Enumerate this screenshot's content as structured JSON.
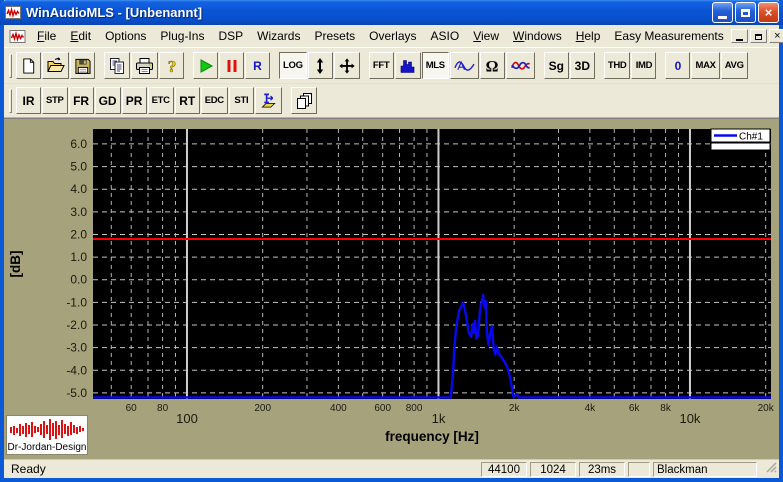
{
  "window": {
    "title": "WinAudioMLS - [Unbenannt]"
  },
  "menubar": {
    "items": [
      {
        "label": "File",
        "underline": 0
      },
      {
        "label": "Edit",
        "underline": 0
      },
      {
        "label": "Options"
      },
      {
        "label": "Plug-Ins"
      },
      {
        "label": "DSP"
      },
      {
        "label": "Wizards"
      },
      {
        "label": "Presets"
      },
      {
        "label": "Overlays"
      },
      {
        "label": "ASIO"
      },
      {
        "label": "View",
        "underline": 0
      },
      {
        "label": "Windows",
        "underline": 0
      },
      {
        "label": "Help",
        "underline": 0
      },
      {
        "label": "Easy Measurements"
      }
    ]
  },
  "toolbar_main": {
    "buttons": [
      {
        "name": "new-file-button",
        "icon": "new-doc"
      },
      {
        "name": "open-file-button",
        "icon": "open-folder"
      },
      {
        "name": "save-button",
        "icon": "save-floppy"
      },
      {
        "gap": true
      },
      {
        "name": "copy-button",
        "icon": "copy"
      },
      {
        "name": "print-button",
        "icon": "printer"
      },
      {
        "name": "help-button",
        "icon": "help"
      },
      {
        "gap": true
      },
      {
        "name": "play-button",
        "icon": "play"
      },
      {
        "name": "pause-button",
        "icon": "pause"
      },
      {
        "name": "record-button",
        "label": "R",
        "color": "#1414CC"
      },
      {
        "gap": true
      },
      {
        "name": "log-scale-button",
        "label": "LOG",
        "small": true,
        "active": true
      },
      {
        "name": "vertical-zoom-button",
        "icon": "v-arrows"
      },
      {
        "name": "pan-button",
        "icon": "move-arrows"
      },
      {
        "gap": true
      },
      {
        "name": "fft-button",
        "label": "FFT",
        "small": true
      },
      {
        "name": "spectrum-button",
        "icon": "spectrum-bars"
      },
      {
        "name": "mls-button",
        "label": "MLS",
        "small": true,
        "active": true
      },
      {
        "name": "scope-button",
        "icon": "scope-wave"
      },
      {
        "name": "impedance-button",
        "icon": "omega"
      },
      {
        "name": "wow-flutter-button",
        "icon": "dual-wave"
      },
      {
        "gap": true
      },
      {
        "name": "signal-generator-button",
        "label": "Sg"
      },
      {
        "name": "3d-view-button",
        "label": "3D"
      },
      {
        "gap": true
      },
      {
        "name": "thd-button",
        "label": "THD",
        "small": true
      },
      {
        "name": "imd-button",
        "label": "IMD",
        "small": true
      },
      {
        "gap": true
      },
      {
        "name": "zero-button",
        "label": "0",
        "color": "#1414CC"
      },
      {
        "name": "max-button",
        "label": "MAX",
        "small": true
      },
      {
        "name": "avg-button",
        "label": "AVG",
        "small": true
      }
    ]
  },
  "toolbar_measure": {
    "buttons": [
      {
        "name": "impulse-response-button",
        "label": "IR"
      },
      {
        "name": "step-response-button",
        "label": "STP",
        "small": true
      },
      {
        "name": "frequency-response-button",
        "label": "FR"
      },
      {
        "name": "group-delay-button",
        "label": "GD"
      },
      {
        "name": "phase-response-button",
        "label": "PR"
      },
      {
        "name": "energy-time-curve-button",
        "label": "ETC",
        "small": true
      },
      {
        "name": "reverberation-time-button",
        "label": "RT"
      },
      {
        "name": "energy-decay-curve-button",
        "label": "EDC",
        "small": true
      },
      {
        "name": "sti-button",
        "label": "STI",
        "small": true
      },
      {
        "name": "export-report-button",
        "icon": "export"
      },
      {
        "gap": true
      },
      {
        "name": "cascade-windows-button",
        "icon": "cascade"
      }
    ]
  },
  "chart_data": {
    "type": "line",
    "title": "",
    "xlabel": "frequency [Hz]",
    "ylabel": "[dB]",
    "x_scale": "log",
    "xlim": [
      42.3,
      21000
    ],
    "ylim": [
      -5.27,
      6.66
    ],
    "grid": true,
    "y_ticks": [
      {
        "v": 6,
        "label": "6.0"
      },
      {
        "v": 5,
        "label": "5.0"
      },
      {
        "v": 4,
        "label": "4.0"
      },
      {
        "v": 3,
        "label": "3.0"
      },
      {
        "v": 2,
        "label": "2.0"
      },
      {
        "v": 1,
        "label": "1.0"
      },
      {
        "v": 0,
        "label": "0.0"
      },
      {
        "v": -1,
        "label": "-1.0"
      },
      {
        "v": -2,
        "label": "-2.0"
      },
      {
        "v": -3,
        "label": "-3.0"
      },
      {
        "v": -4,
        "label": "-4.0"
      },
      {
        "v": -5,
        "label": "-5.0"
      }
    ],
    "x_major": [
      {
        "v": 100,
        "label": "100"
      },
      {
        "v": 1000,
        "label": "1k"
      },
      {
        "v": 10000,
        "label": "10k"
      }
    ],
    "x_minor": [
      {
        "v": 50
      },
      {
        "v": 60,
        "label": "60"
      },
      {
        "v": 70
      },
      {
        "v": 80,
        "label": "80"
      },
      {
        "v": 90
      },
      {
        "v": 200,
        "label": "200"
      },
      {
        "v": 300
      },
      {
        "v": 400,
        "label": "400"
      },
      {
        "v": 500
      },
      {
        "v": 600,
        "label": "600"
      },
      {
        "v": 700
      },
      {
        "v": 800,
        "label": "800"
      },
      {
        "v": 900
      },
      {
        "v": 2000,
        "label": "2k"
      },
      {
        "v": 3000
      },
      {
        "v": 4000,
        "label": "4k"
      },
      {
        "v": 5000
      },
      {
        "v": 6000,
        "label": "6k"
      },
      {
        "v": 7000
      },
      {
        "v": 8000,
        "label": "8k"
      },
      {
        "v": 9000
      },
      {
        "v": 20000,
        "label": "20k"
      }
    ],
    "overlay_line": {
      "db": 1.8,
      "color": "#FF0000"
    },
    "legend": {
      "position": "top-right",
      "entries": [
        {
          "label": "Ch#1",
          "color": "#0808F0"
        }
      ]
    },
    "series": [
      {
        "name": "Ch#1",
        "color": "#0808F0",
        "points": [
          [
            42.3,
            -5.2
          ],
          [
            1118,
            -5.2
          ],
          [
            1140,
            -4.3
          ],
          [
            1155,
            -3.1
          ],
          [
            1175,
            -2.1
          ],
          [
            1210,
            -1.35
          ],
          [
            1255,
            -1.02
          ],
          [
            1285,
            -1.55
          ],
          [
            1320,
            -2.35
          ],
          [
            1350,
            -2.52
          ],
          [
            1368,
            -1.95
          ],
          [
            1382,
            -2.35
          ],
          [
            1398,
            -1.82
          ],
          [
            1415,
            -2.6
          ],
          [
            1438,
            -2.45
          ],
          [
            1462,
            -1.35
          ],
          [
            1505,
            -0.68
          ],
          [
            1525,
            -1.25
          ],
          [
            1542,
            -0.95
          ],
          [
            1558,
            -2.3
          ],
          [
            1582,
            -2.9
          ],
          [
            1605,
            -2.4
          ],
          [
            1632,
            -2.05
          ],
          [
            1658,
            -3.05
          ],
          [
            1682,
            -3.3
          ],
          [
            1705,
            -2.95
          ],
          [
            1732,
            -3.25
          ],
          [
            1775,
            -3.4
          ],
          [
            1822,
            -3.6
          ],
          [
            1868,
            -3.8
          ],
          [
            1912,
            -4.15
          ],
          [
            1952,
            -4.65
          ],
          [
            1988,
            -5.2
          ],
          [
            2050,
            -5.05
          ],
          [
            2090,
            -5.2
          ],
          [
            21000,
            -5.2
          ]
        ]
      }
    ]
  },
  "logo": {
    "text": "Dr-Jordan-Design"
  },
  "statusbar": {
    "message": "Ready",
    "panels": [
      "44100",
      "1024",
      "23ms",
      "",
      "Blackman"
    ]
  },
  "colors": {
    "titlebar_blue": "#0A55D5",
    "window_border": "#0C59D6",
    "chrome": "#ECE9D8",
    "client_bg": "#A6A37C",
    "plot_bg": "#000000",
    "grid_line": "#C4C4C4",
    "curve_blue": "#0808F0",
    "overlay_red": "#FF0000"
  }
}
